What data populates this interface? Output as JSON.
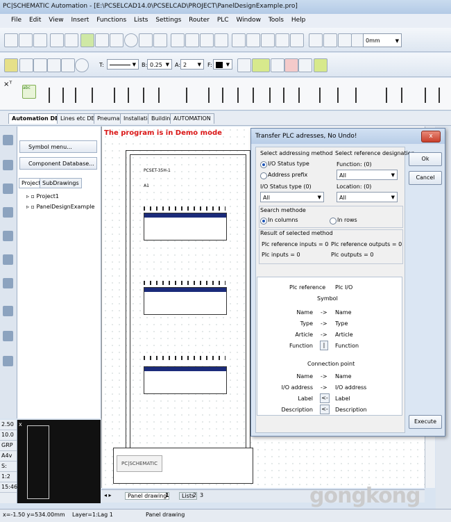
{
  "window": {
    "title": "PC|SCHEMATIC Automation - [E:\\PCSELCAD14.0\\PCSELCAD\\PROJECT\\PanelDesignExample.pro]"
  },
  "menu": [
    "File",
    "Edit",
    "View",
    "Insert",
    "Functions",
    "Lists",
    "Settings",
    "Router",
    "PLC",
    "Window",
    "Tools",
    "Help"
  ],
  "toolbar": {
    "zoom_value": "0mm",
    "line_B": "0.25",
    "line_A": "2",
    "fill_F": ""
  },
  "tabs": [
    "Automation DEMO",
    "Lines etc DEMO",
    "Pneumatic",
    "Installation",
    "Building",
    "AUTOMATION"
  ],
  "left_panel": {
    "symbol_menu": "Symbol menu...",
    "component_db": "Component Database...",
    "tab_projects": "Projects",
    "tab_subdrawings": "SubDrawings",
    "tree": [
      "Project1",
      "PanelDesignExample"
    ]
  },
  "drawing": {
    "demo_text": "The program is in Demo mode",
    "header": "PCSET-35H-1",
    "sheet_tag": "A1"
  },
  "side_status": [
    "2.50",
    "10.0",
    "GRP",
    "A4v",
    "S:",
    "1:2",
    "15:46"
  ],
  "sheet_tabs": {
    "panel_label": "Panel drawing",
    "num1": "1",
    "lists": "Lists",
    "num2": "2",
    "num3": "3"
  },
  "statusbar": {
    "coords": "x=-1.50 y=534.00mm",
    "layer": "Layer=1:Lag 1",
    "page": "Panel drawing"
  },
  "dialog": {
    "title": "Transfer PLC adresses, No Undo!",
    "close": "x",
    "sel_method_label": "Select addressing method",
    "opt_io_status": "I/O Status type",
    "opt_address_prefix": "Address prefix",
    "io_status_label": "I/O Status type (0)",
    "io_status_value": "All",
    "ref_designation_label": "Select reference designation:",
    "function_label": "Function: (0)",
    "function_value": "All",
    "location_label": "Location: (0)",
    "location_value": "All",
    "search_label": "Search methode",
    "opt_columns": "In columns",
    "opt_rows": "In rows",
    "result_label": "Result of selected method",
    "plc_ref_inputs": "Plc reference inputs = 0",
    "plc_ref_outputs": "Plc reference outputs = 0",
    "plc_inputs": "Plc inputs = 0",
    "plc_outputs": "Plc outputs = 0",
    "map_header_left": "Plc reference",
    "map_header_right": "Plc I/O",
    "map_symbol": "Symbol",
    "map_rows_symbol": [
      {
        "left": "Name",
        "arrow": "->",
        "right": "Name"
      },
      {
        "left": "Type",
        "arrow": "->",
        "right": "Type"
      },
      {
        "left": "Article",
        "arrow": "->",
        "right": "Article"
      },
      {
        "left": "Function",
        "arrow": "|",
        "right": "Function"
      }
    ],
    "map_connection": "Connection point",
    "map_rows_conn": [
      {
        "left": "Name",
        "arrow": "->",
        "right": "Name"
      },
      {
        "left": "I/O address",
        "arrow": "->",
        "right": "I/O address"
      },
      {
        "left": "Label",
        "arrow": "<-",
        "right": "Label"
      },
      {
        "left": "Description",
        "arrow": "<-",
        "right": "Description"
      }
    ],
    "btn_ok": "Ok",
    "btn_cancel": "Cancel",
    "btn_execute": "Execute"
  },
  "logo": "PC|SCHEMATIC",
  "watermark": "gongkong"
}
